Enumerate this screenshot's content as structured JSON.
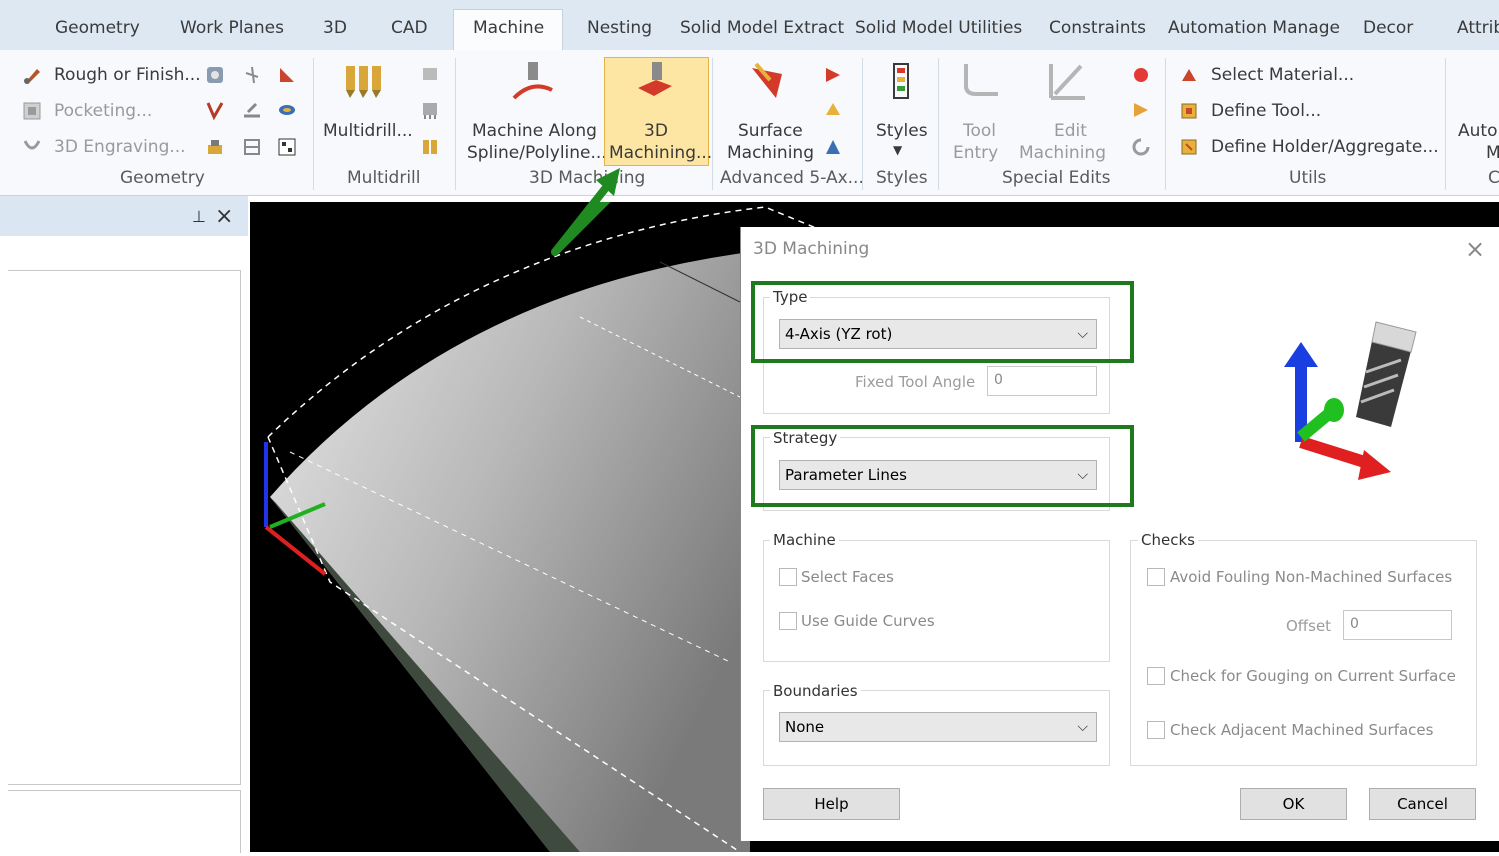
{
  "tabs": [
    "Geometry",
    "Work Planes",
    "3D",
    "CAD",
    "Machine",
    "Nesting",
    "Solid Model Extract",
    "Solid Model Utilities",
    "Constraints",
    "Automation Manage",
    "Decor",
    "Attrib"
  ],
  "ribbon": {
    "geometry": {
      "items": [
        "Rough or Finish...",
        "Pocketing...",
        "3D Engraving..."
      ],
      "group": "Geometry"
    },
    "multidrill": {
      "label": "Multidrill...",
      "group": "Multidrill"
    },
    "machining3d": {
      "along_1": "Machine Along",
      "along_2": "Spline/Polyline...",
      "m3d_1": "3D",
      "m3d_2": "Machining...",
      "group": "3D Machining"
    },
    "advanced": {
      "surface_1": "Surface",
      "surface_2": "Machining",
      "group": "Advanced 5-Ax..."
    },
    "styles": {
      "label": "Styles",
      "group": "Styles"
    },
    "special": {
      "tool_1": "Tool",
      "tool_2": "Entry",
      "edit_1": "Edit",
      "edit_2": "Machining",
      "group": "Special Edits"
    },
    "utils": {
      "items": [
        "Select Material...",
        "Define Tool...",
        "Define Holder/Aggregate..."
      ],
      "group": "Utils"
    },
    "auto": {
      "l1": "Auto",
      "l2": "M",
      "l3": "C"
    }
  },
  "panel": {
    "pin": "⊥",
    "close": "×"
  },
  "dialog": {
    "title": "3D Machining",
    "close": "×",
    "type": {
      "label": "Type",
      "value": "4-Axis (YZ rot)",
      "fixed_label": "Fixed Tool Angle",
      "fixed_value": "0"
    },
    "strategy": {
      "label": "Strategy",
      "value": "Parameter Lines"
    },
    "machine": {
      "label": "Machine",
      "select_faces": "Select Faces",
      "guide_curves": "Use Guide Curves"
    },
    "boundaries": {
      "label": "Boundaries",
      "value": "None"
    },
    "checks": {
      "label": "Checks",
      "avoid": "Avoid Fouling Non-Machined Surfaces",
      "offset_label": "Offset",
      "offset_value": "0",
      "gouging": "Check for Gouging on Current Surface",
      "adjacent": "Check Adjacent Machined Surfaces"
    },
    "buttons": {
      "help": "Help",
      "ok": "OK",
      "cancel": "Cancel"
    }
  },
  "colors": {
    "highlight": "#1f7a1f",
    "active_button": "#fde6a3",
    "tabbar": "#dde8f3"
  }
}
